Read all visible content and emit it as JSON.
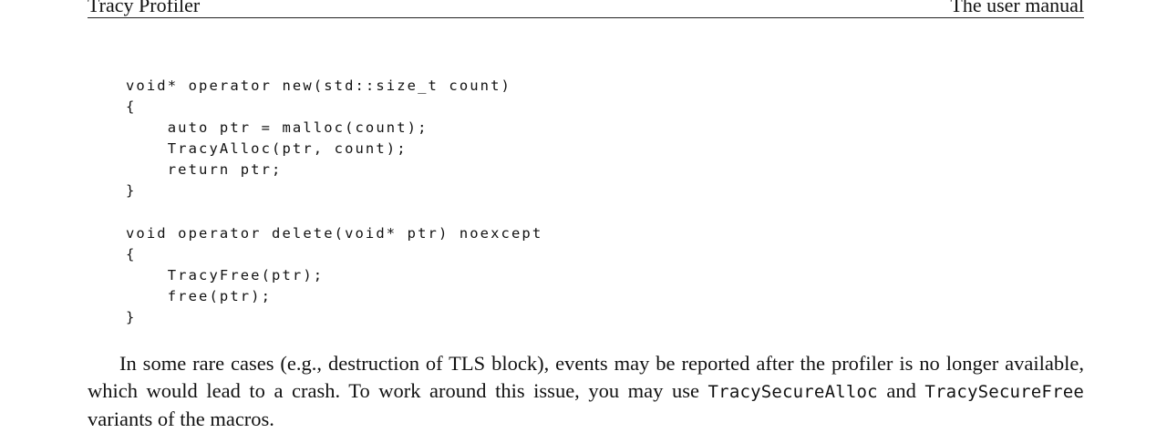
{
  "header": {
    "left_title": "Tracy Profiler",
    "right_title": "The user manual"
  },
  "code_lines": [
    "void* operator new(std::size_t count)",
    "{",
    "    auto ptr = malloc(count);",
    "    TracyAlloc(ptr, count);",
    "    return ptr;",
    "}",
    "",
    "void operator delete(void* ptr) noexcept",
    "{",
    "    TracyFree(ptr);",
    "    free(ptr);",
    "}"
  ],
  "paragraph": {
    "text_1": "In some rare cases (e.g., destruction of TLS block), events may be reported after the profiler is no longer available, which would lead to a crash.  To work around this issue, you may use ",
    "code_1": "TracySecureAlloc",
    "text_2": " and ",
    "code_2": "TracySecureFree",
    "text_3": " variants of the macros."
  }
}
